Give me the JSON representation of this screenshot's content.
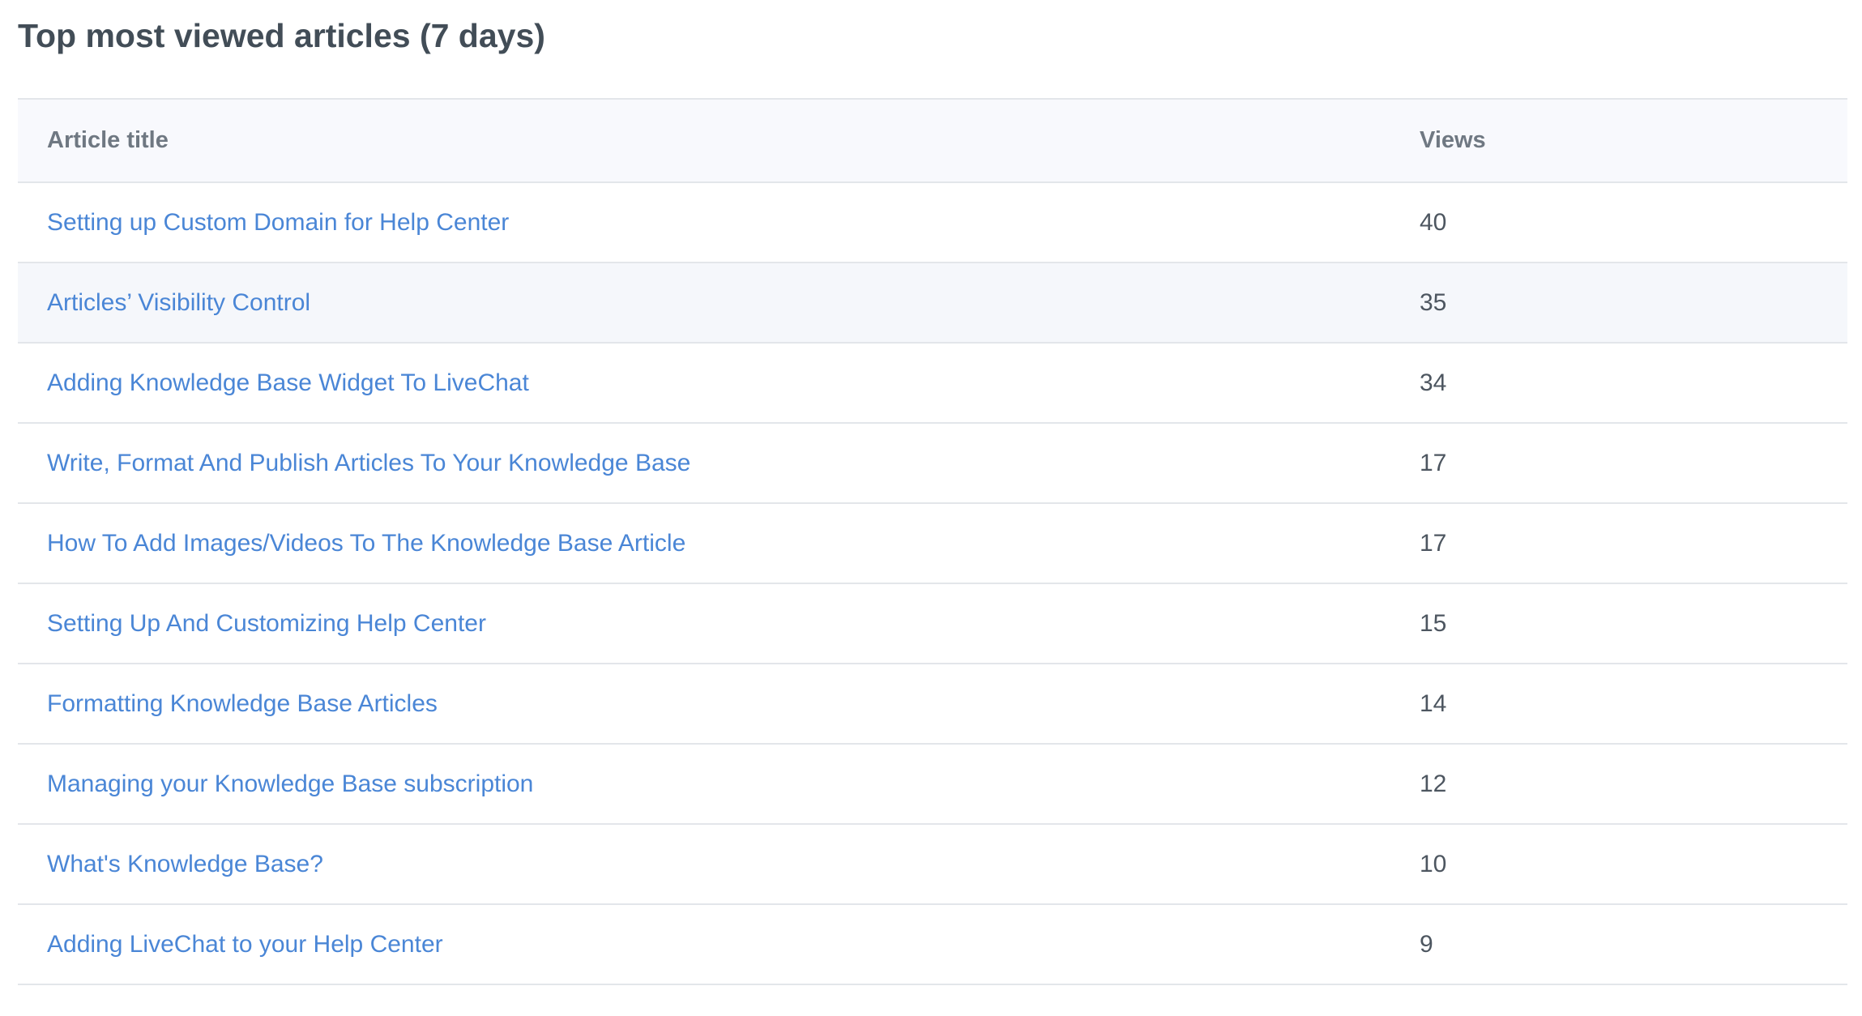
{
  "page": {
    "title": "Top most viewed articles (7 days)"
  },
  "table": {
    "columns": [
      "Article title",
      "Views"
    ],
    "rows": [
      {
        "title": "Setting up Custom Domain for Help Center",
        "views": "40"
      },
      {
        "title": "Articles’ Visibility Control",
        "views": "35"
      },
      {
        "title": "Adding Knowledge Base Widget To LiveChat",
        "views": "34"
      },
      {
        "title": "Write, Format And Publish Articles To Your Knowledge Base",
        "views": "17"
      },
      {
        "title": "How To Add Images/Videos To The Knowledge Base Article",
        "views": "17"
      },
      {
        "title": "Setting Up And Customizing Help Center",
        "views": "15"
      },
      {
        "title": "Formatting Knowledge Base Articles",
        "views": "14"
      },
      {
        "title": "Managing your Knowledge Base subscription",
        "views": "12"
      },
      {
        "title": "What's Knowledge Base?",
        "views": "10"
      },
      {
        "title": "Adding LiveChat to your Help Center",
        "views": "9"
      }
    ]
  },
  "colors": {
    "title_text": "#424d57",
    "header_bg": "#f8f9fd",
    "header_text": "#6f7882",
    "link": "#4a86d6",
    "value_text": "#4d5660",
    "row_border": "#e3e6ea",
    "hover_row_bg": "#f5f7fb"
  }
}
